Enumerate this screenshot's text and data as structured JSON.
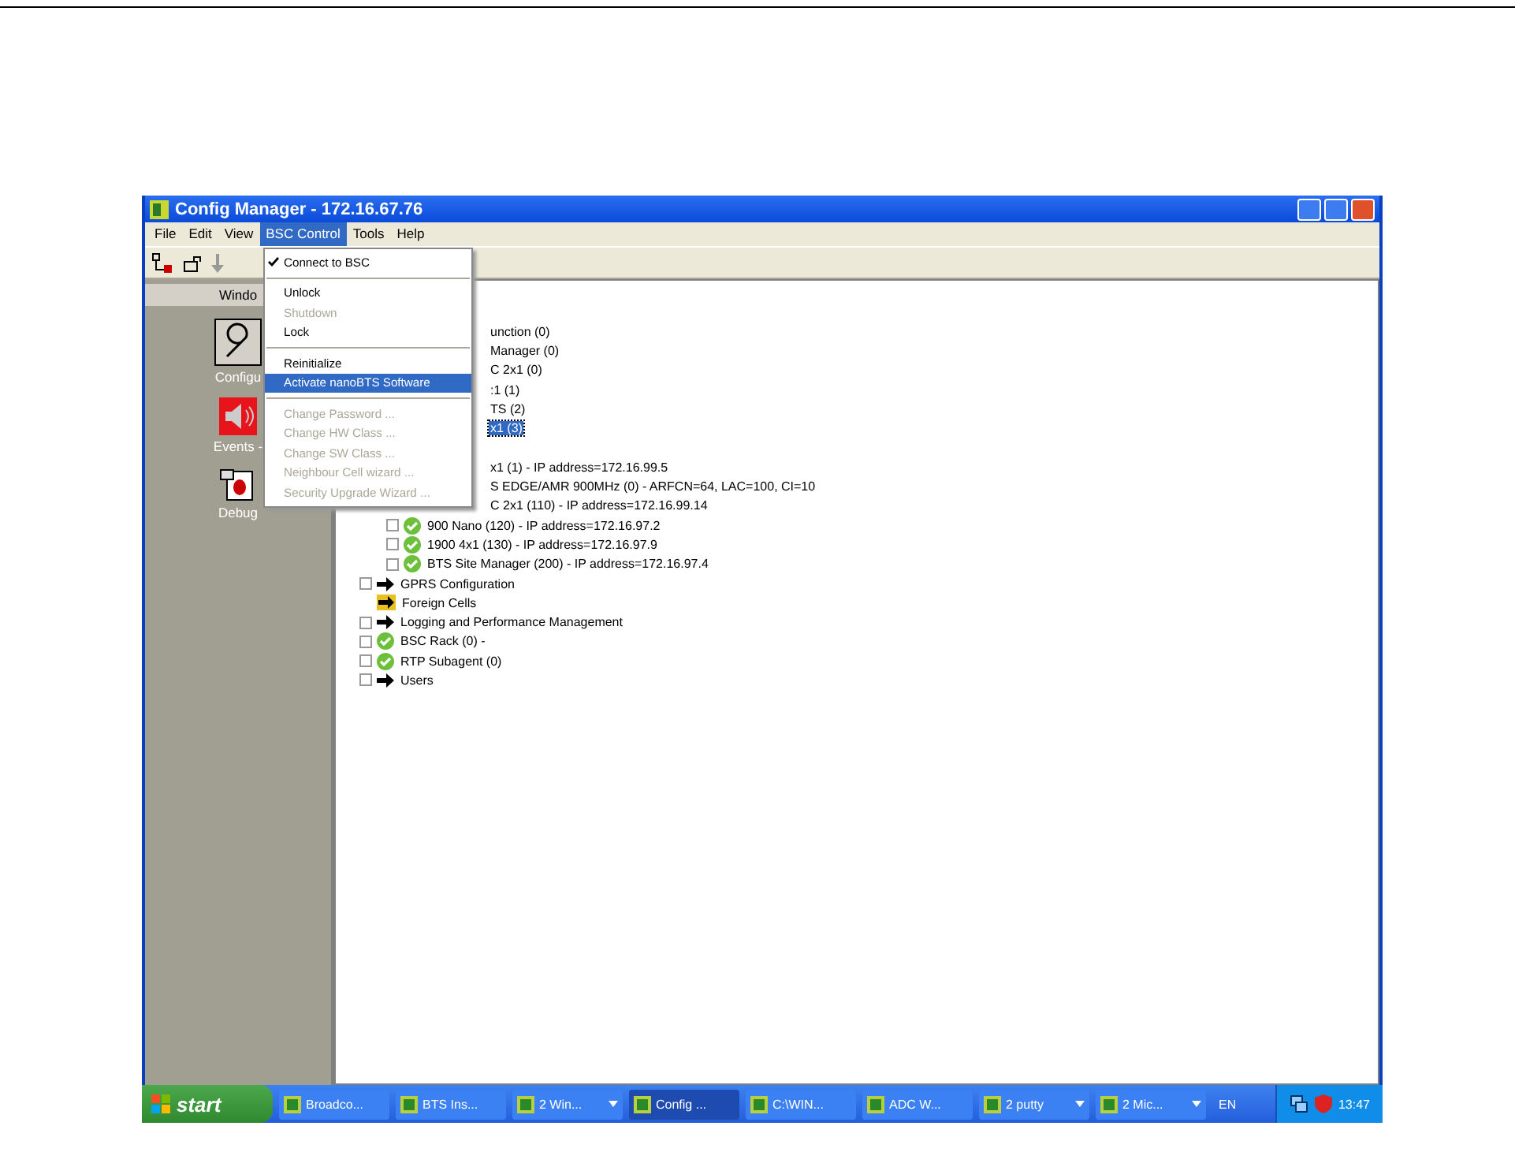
{
  "window": {
    "title": "Config Manager - 172.16.67.76"
  },
  "menubar": [
    {
      "label": "File",
      "selected": false
    },
    {
      "label": "Edit",
      "selected": false
    },
    {
      "label": "View",
      "selected": false
    },
    {
      "label": "BSC Control",
      "selected": true
    },
    {
      "label": "Tools",
      "selected": false
    },
    {
      "label": "Help",
      "selected": false
    }
  ],
  "open_menu": {
    "items": [
      {
        "kind": "item",
        "label": "Connect to BSC",
        "checked": true,
        "disabled": false,
        "selected": false
      },
      {
        "kind": "separator"
      },
      {
        "kind": "item",
        "label": "Unlock",
        "checked": false,
        "disabled": false,
        "selected": false
      },
      {
        "kind": "item",
        "label": "Shutdown",
        "checked": false,
        "disabled": true,
        "selected": false
      },
      {
        "kind": "item",
        "label": "Lock",
        "checked": false,
        "disabled": false,
        "selected": false
      },
      {
        "kind": "separator"
      },
      {
        "kind": "item",
        "label": "Reinitialize",
        "checked": false,
        "disabled": false,
        "selected": false
      },
      {
        "kind": "item",
        "label": "Activate nanoBTS Software",
        "checked": false,
        "disabled": false,
        "selected": true
      },
      {
        "kind": "separator"
      },
      {
        "kind": "item",
        "label": "Change Password ...",
        "checked": false,
        "disabled": true,
        "selected": false
      },
      {
        "kind": "item",
        "label": "Change HW Class ...",
        "checked": false,
        "disabled": true,
        "selected": false
      },
      {
        "kind": "item",
        "label": "Change SW Class ...",
        "checked": false,
        "disabled": true,
        "selected": false
      },
      {
        "kind": "item",
        "label": "Neighbour Cell wizard ...",
        "checked": false,
        "disabled": true,
        "selected": false
      },
      {
        "kind": "item",
        "label": "Security Upgrade Wizard ...",
        "checked": false,
        "disabled": true,
        "selected": false
      }
    ]
  },
  "left_panel": {
    "header": "Windo",
    "items": [
      {
        "label": "Configu"
      },
      {
        "label": "Events - "
      },
      {
        "label": "Debug"
      }
    ]
  },
  "tree": {
    "partial_rows": [
      {
        "text": "unction (0)",
        "selected": false
      },
      {
        "text": "Manager (0)",
        "selected": false
      },
      {
        "text": "C 2x1 (0)",
        "selected": false
      },
      {
        "text": ":1 (1)",
        "selected": false
      },
      {
        "text": "TS (2)",
        "selected": false
      },
      {
        "text": "x1 (3)",
        "selected": true
      }
    ],
    "partial_rows_lower": [
      {
        "text": "x1 (1) - IP address=172.16.99.5"
      },
      {
        "text": "S EDGE/AMR 900MHz (0) - ARFCN=64, LAC=100, CI=10"
      },
      {
        "text": "C 2x1 (110) - IP address=172.16.99.14"
      }
    ],
    "branch_rows": [
      {
        "text": "900 Nano (120) - IP address=172.16.97.2",
        "kind": "check",
        "expandable": true
      },
      {
        "text": "1900 4x1 (130) - IP address=172.16.97.9",
        "kind": "check",
        "expandable": true
      },
      {
        "text": "BTS Site Manager (200) - IP address=172.16.97.4",
        "kind": "check",
        "expandable": true
      }
    ],
    "rows": [
      {
        "text": "GPRS Configuration",
        "kind": "arrow",
        "expandable": true
      },
      {
        "text": "Foreign Cells",
        "kind": "folder",
        "expandable": false
      },
      {
        "text": "Logging and Performance Management",
        "kind": "arrow",
        "expandable": true
      },
      {
        "text": "BSC Rack (0) -",
        "kind": "check",
        "expandable": true
      },
      {
        "text": "RTP Subagent (0)",
        "kind": "check",
        "expandable": true
      },
      {
        "text": "Users",
        "kind": "arrow",
        "expandable": true
      }
    ]
  },
  "taskbar": {
    "start": "start",
    "tasks": [
      {
        "label": "Broadco...",
        "selected": false,
        "dropdown": false
      },
      {
        "label": "BTS Ins...",
        "selected": false,
        "dropdown": false
      },
      {
        "label": "2 Win...",
        "selected": false,
        "dropdown": true
      },
      {
        "label": "Config ...",
        "selected": true,
        "dropdown": false
      },
      {
        "label": "C:\\WIN...",
        "selected": false,
        "dropdown": false
      },
      {
        "label": "ADC W...",
        "selected": false,
        "dropdown": false
      },
      {
        "label": "2 putty",
        "selected": false,
        "dropdown": true
      },
      {
        "label": "2 Mic...",
        "selected": false,
        "dropdown": true
      }
    ],
    "language": "EN",
    "clock": "13:47"
  }
}
